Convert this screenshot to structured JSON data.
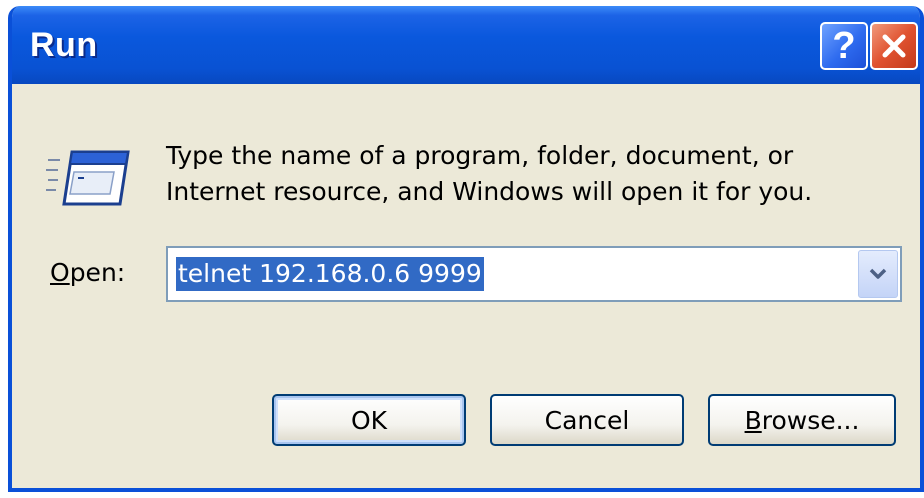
{
  "window": {
    "title": "Run"
  },
  "titlebar": {
    "help_button": "?",
    "close_button": "close"
  },
  "description": {
    "line1": "Type the name of a program, folder, document, or",
    "line2": "Internet resource, and Windows will open it for you."
  },
  "open_field": {
    "label_mnemonic": "O",
    "label_rest": "pen:",
    "value": "telnet 192.168.0.6 9999"
  },
  "buttons": {
    "ok": "OK",
    "cancel": "Cancel",
    "browse_mnemonic": "B",
    "browse_rest": "rowse..."
  },
  "icons": {
    "run": "run-program-icon",
    "help": "help-icon",
    "close": "close-icon",
    "dropdown": "chevron-down-icon"
  },
  "colors": {
    "titlebar": "#0A58DD",
    "dialog_bg": "#ECE9D8",
    "selection": "#316AC5",
    "close": "#E05230"
  }
}
